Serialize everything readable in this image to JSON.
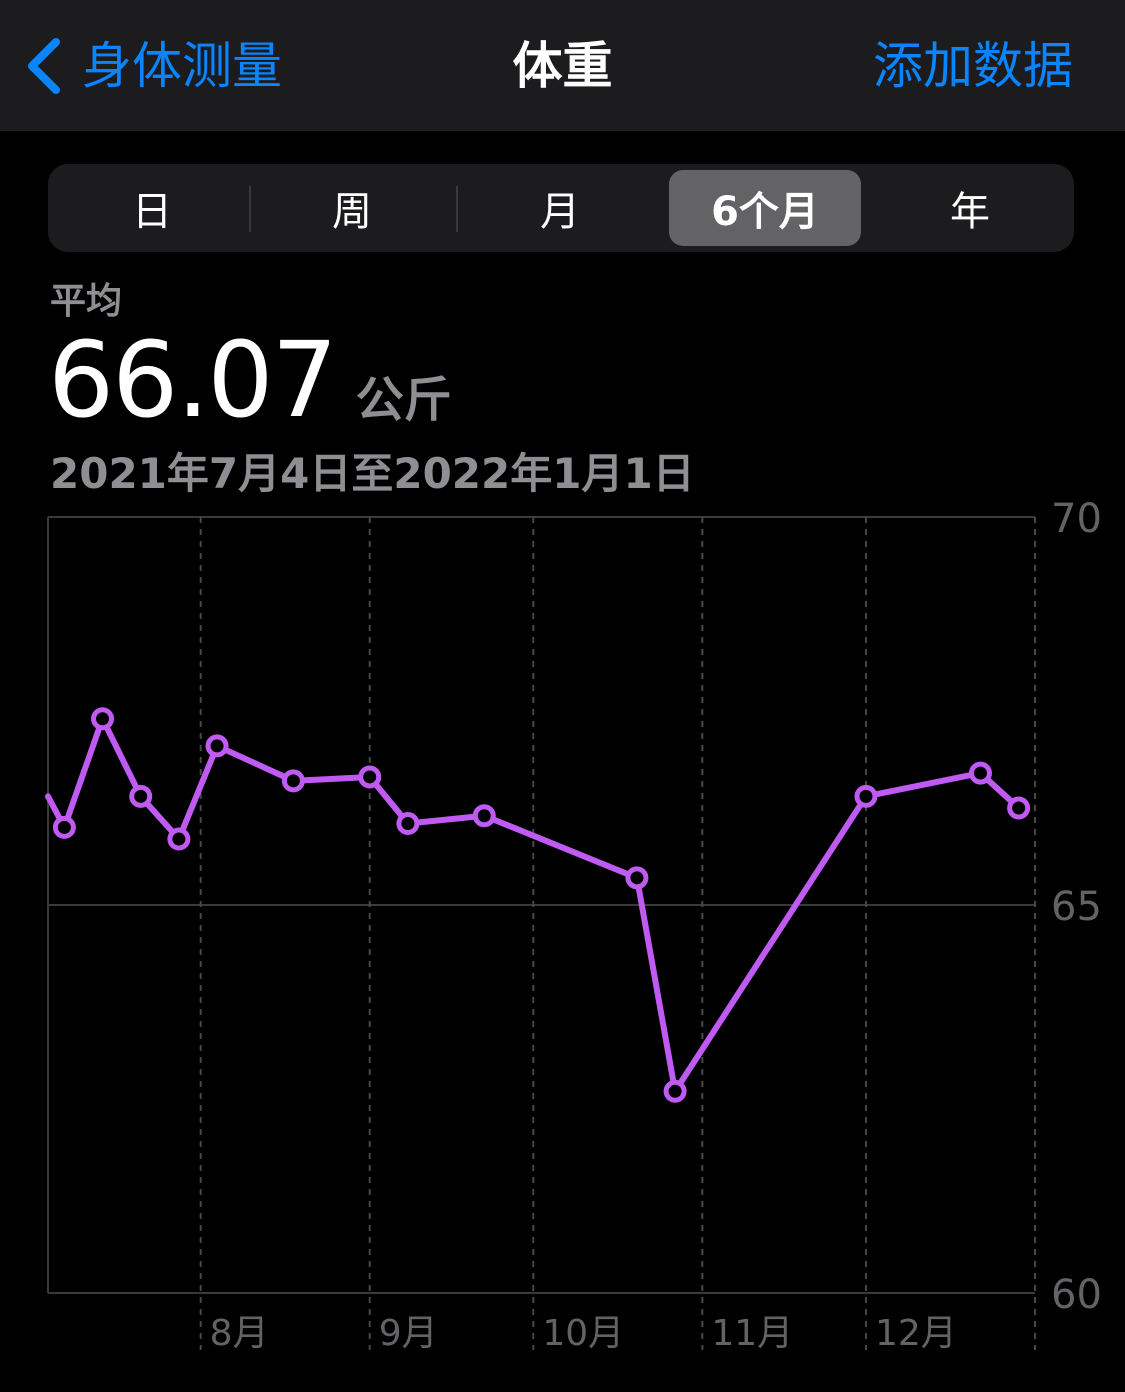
{
  "nav": {
    "back_label": "身体测量",
    "title": "体重",
    "action_label": "添加数据"
  },
  "segments": {
    "day": "日",
    "week": "周",
    "month": "月",
    "six_months": "6个月",
    "year": "年",
    "selected": "6个月"
  },
  "summary": {
    "average_label": "平均",
    "average_value": "66.07",
    "unit": "公斤",
    "date_range": "2021年7月4日至2022年1月1日"
  },
  "colors": {
    "accent": "#0a84ff",
    "series": "#bf5af2",
    "segment_selected": "#636366"
  },
  "icons": {
    "back": "chevron-left-icon"
  },
  "chart_data": {
    "type": "line",
    "y_ticks": [
      "70",
      "65",
      "60"
    ],
    "x_ticks": [
      "8月",
      "9月",
      "10月",
      "11月",
      "12月"
    ],
    "ylim": [
      60,
      70
    ],
    "xlim": [
      "2021-07-04",
      "2022-01-01"
    ],
    "grid": true,
    "y_axis_side": "right",
    "series": [
      {
        "x": [
          "2021-07-04",
          "2021-07-07",
          "2021-07-14",
          "2021-07-21",
          "2021-07-28",
          "2021-08-04",
          "2021-08-18",
          "2021-09-01",
          "2021-09-08",
          "2021-09-22",
          "2021-10-20",
          "2021-10-27",
          "2021-12-01",
          "2021-12-22",
          "2021-12-29"
        ],
        "y": [
          66.4,
          66.0,
          67.4,
          66.4,
          65.85,
          67.05,
          66.6,
          66.65,
          66.05,
          66.15,
          65.35,
          62.6,
          66.4,
          66.7,
          66.25
        ]
      }
    ]
  }
}
